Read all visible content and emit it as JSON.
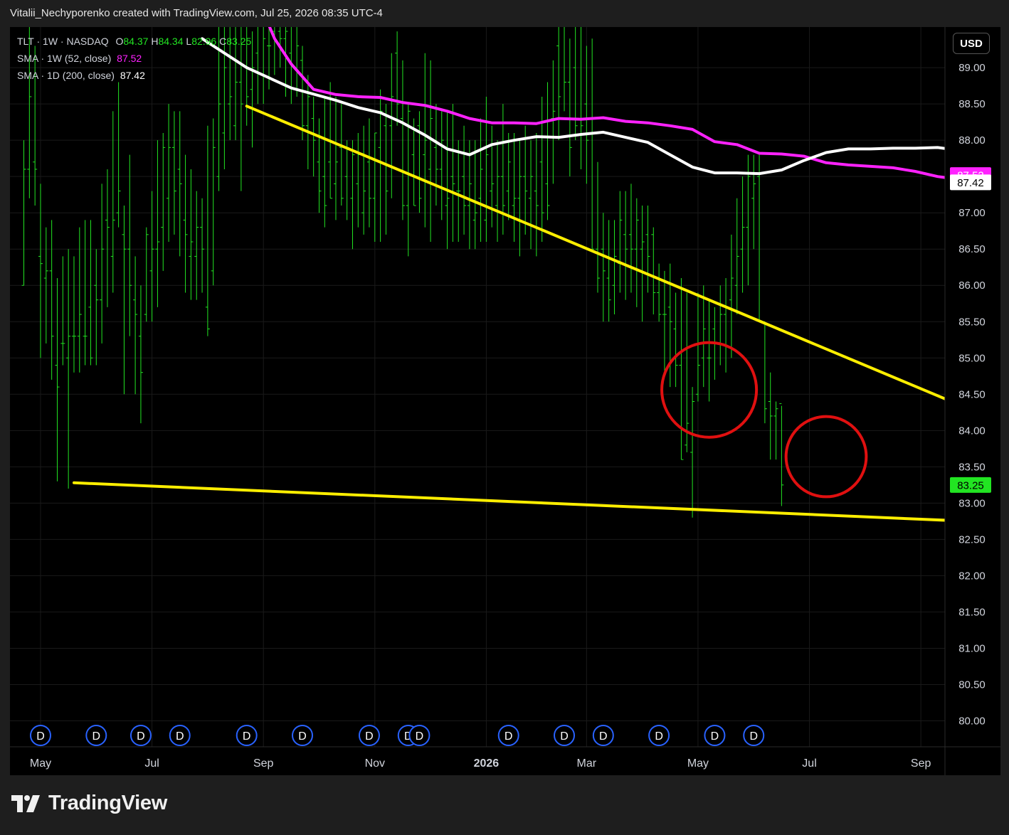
{
  "header": {
    "attribution": "Vitalii_Nechyporenko created with TradingView.com, Jul 25, 2026 08:35 UTC-4"
  },
  "legend": {
    "symbol": "TLT · 1W · NASDAQ",
    "o_label": "O",
    "o_value": "84.37",
    "h_label": "H",
    "h_value": "84.34",
    "l_label": "L",
    "l_value": "82.96",
    "c_label": "C",
    "c_value": "83.25",
    "sma1_label": "SMA · 1W (52, close)",
    "sma1_value": "87.52",
    "sma2_label": "SMA · 1D (200, close)",
    "sma2_value": "87.42"
  },
  "currency": "USD",
  "footer": {
    "brand": "TradingView"
  },
  "colors": {
    "background": "#000000",
    "bars": "#22e522",
    "sma52": "#ff22ff",
    "sma200": "#ffffff",
    "trendline": "#ffee00",
    "circle": "#e01010",
    "dividend": "#2962ff",
    "grid": "#1a1a1a"
  },
  "chart_data": {
    "type": "ohlc",
    "interval": "1W",
    "ylim": [
      79.85,
      89.55
    ],
    "y_ticks": [
      "80.00",
      "80.50",
      "81.00",
      "81.50",
      "82.00",
      "82.50",
      "83.00",
      "83.50",
      "84.00",
      "84.50",
      "85.00",
      "85.50",
      "86.00",
      "86.50",
      "87.00",
      "87.50",
      "88.00",
      "88.50",
      "89.00"
    ],
    "x_labels": [
      "May",
      "Jul",
      "Sep",
      "Nov",
      "2026",
      "Mar",
      "May",
      "Jul",
      "Sep"
    ],
    "x_label_index": [
      3,
      23,
      43,
      63,
      83,
      101,
      121,
      141,
      161
    ],
    "price_tags": [
      {
        "value": 87.52,
        "text": "87.52",
        "bg": "#ff22ff",
        "fg": "#ffffff"
      },
      {
        "value": 87.42,
        "text": "87.42",
        "bg": "#ffffff",
        "fg": "#000000"
      },
      {
        "value": 83.25,
        "text": "83.25",
        "bg": "#22e522",
        "fg": "#000000"
      }
    ],
    "ohlc": [
      [
        86.0,
        88.0,
        86.0,
        87.6
      ],
      [
        87.6,
        89.7,
        87.2,
        88.6
      ],
      [
        87.7,
        89.3,
        87.1,
        87.6
      ],
      [
        86.4,
        87.4,
        85.0,
        86.3
      ],
      [
        86.1,
        86.8,
        85.2,
        86.2
      ],
      [
        86.2,
        86.9,
        84.7,
        85.3
      ],
      [
        84.9,
        86.1,
        83.3,
        84.6
      ],
      [
        85.2,
        86.4,
        84.9,
        85.2
      ],
      [
        85.0,
        86.5,
        83.2,
        85.3
      ],
      [
        85.3,
        86.4,
        84.8,
        85.3
      ],
      [
        85.3,
        86.8,
        84.8,
        85.6
      ],
      [
        85.3,
        86.9,
        84.9,
        85.3
      ],
      [
        85.7,
        86.9,
        84.9,
        85.0
      ],
      [
        86.0,
        86.5,
        84.9,
        85.8
      ],
      [
        85.8,
        87.4,
        85.2,
        86.5
      ],
      [
        86.9,
        87.6,
        85.7,
        86.8
      ],
      [
        86.4,
        88.4,
        85.9,
        86.9
      ],
      [
        87.0,
        88.8,
        86.8,
        87.3
      ],
      [
        86.7,
        87.1,
        84.5,
        86.5
      ],
      [
        86.5,
        87.8,
        85.3,
        86.0
      ],
      [
        85.8,
        86.4,
        84.5,
        85.6
      ],
      [
        85.3,
        86.0,
        84.1,
        84.8
      ],
      [
        85.6,
        86.8,
        85.5,
        86.7
      ],
      [
        86.2,
        87.3,
        85.5,
        86.5
      ],
      [
        86.5,
        88.0,
        85.7,
        86.6
      ],
      [
        86.8,
        88.1,
        86.2,
        87.9
      ],
      [
        87.2,
        88.5,
        86.6,
        87.9
      ],
      [
        87.9,
        88.4,
        86.7,
        87.3
      ],
      [
        87.6,
        88.4,
        86.4,
        87.4
      ],
      [
        86.9,
        87.8,
        85.9,
        86.7
      ],
      [
        86.4,
        87.6,
        85.8,
        86.6
      ],
      [
        86.4,
        87.3,
        85.8,
        86.8
      ],
      [
        86.8,
        87.2,
        85.9,
        86.5
      ],
      [
        85.7,
        88.2,
        85.3,
        85.4
      ],
      [
        86.2,
        88.3,
        86.0,
        87.9
      ],
      [
        87.5,
        89.8,
        87.3,
        88.5
      ],
      [
        88.1,
        89.9,
        87.6,
        89.0
      ],
      [
        88.5,
        89.9,
        88.0,
        88.6
      ],
      [
        88.2,
        90.1,
        88.0,
        88.8
      ],
      [
        88.8,
        90.3,
        87.3,
        88.5
      ],
      [
        89.0,
        90.1,
        88.2,
        88.6
      ],
      [
        88.7,
        89.5,
        87.9,
        89.0
      ],
      [
        89.2,
        90.2,
        88.5,
        89.6
      ],
      [
        89.6,
        90.0,
        88.5,
        89.4
      ],
      [
        89.3,
        89.8,
        88.7,
        89.3
      ],
      [
        89.5,
        90.4,
        88.9,
        89.7
      ],
      [
        89.5,
        90.6,
        89.0,
        89.4
      ],
      [
        89.4,
        90.7,
        88.6,
        89.5
      ],
      [
        89.2,
        90.4,
        88.5,
        89.8
      ],
      [
        89.6,
        89.9,
        88.6,
        89.3
      ],
      [
        89.1,
        89.3,
        88.0,
        88.2
      ],
      [
        88.2,
        88.9,
        87.6,
        88.6
      ],
      [
        88.3,
        88.6,
        87.5,
        88.0
      ],
      [
        87.7,
        88.3,
        87.0,
        87.3
      ],
      [
        87.5,
        88.6,
        86.8,
        87.1
      ],
      [
        87.7,
        88.8,
        87.2,
        87.2
      ],
      [
        87.4,
        88.6,
        86.9,
        87.7
      ],
      [
        87.9,
        88.5,
        87.1,
        87.2
      ],
      [
        87.5,
        88.0,
        86.9,
        87.9
      ],
      [
        87.2,
        88.0,
        86.5,
        87.8
      ],
      [
        87.4,
        88.1,
        86.8,
        87.8
      ],
      [
        87.0,
        88.2,
        86.7,
        87.3
      ],
      [
        87.7,
        88.3,
        86.8,
        87.2
      ],
      [
        87.2,
        88.1,
        86.6,
        88.1
      ],
      [
        87.9,
        88.7,
        86.6,
        88.4
      ],
      [
        88.2,
        88.5,
        86.7,
        87.3
      ],
      [
        88.2,
        89.2,
        87.2,
        88.6
      ],
      [
        89.2,
        89.5,
        88.2,
        88.5
      ],
      [
        88.3,
        89.1,
        86.9,
        87.1
      ],
      [
        87.1,
        88.5,
        86.4,
        88.4
      ],
      [
        87.8,
        88.3,
        87.1,
        87.1
      ],
      [
        88.2,
        88.4,
        87.0,
        87.2
      ],
      [
        87.8,
        89.2,
        86.8,
        88.0
      ],
      [
        87.6,
        89.1,
        86.6,
        88.3
      ],
      [
        87.9,
        88.5,
        87.1,
        87.6
      ],
      [
        87.6,
        88.4,
        86.9,
        88.0
      ],
      [
        87.1,
        88.4,
        86.5,
        87.2
      ],
      [
        87.5,
        88.5,
        86.6,
        87.4
      ],
      [
        87.3,
        88.0,
        86.6,
        87.3
      ],
      [
        87.5,
        88.2,
        86.7,
        87.1
      ],
      [
        87.1,
        88.0,
        86.5,
        87.4
      ],
      [
        86.9,
        88.0,
        86.5,
        87.0
      ],
      [
        87.2,
        88.3,
        86.6,
        87.6
      ],
      [
        86.9,
        88.6,
        86.6,
        87.8
      ],
      [
        87.3,
        88.2,
        86.8,
        87.4
      ],
      [
        87.1,
        88.0,
        86.6,
        87.5
      ],
      [
        87.5,
        88.5,
        86.7,
        87.1
      ],
      [
        87.3,
        88.1,
        86.9,
        87.7
      ],
      [
        87.1,
        88.1,
        86.6,
        87.2
      ],
      [
        87.2,
        88.0,
        86.4,
        87.5
      ],
      [
        87.5,
        88.2,
        86.7,
        87.3
      ],
      [
        87.2,
        88.0,
        86.5,
        87.5
      ],
      [
        87.3,
        88.1,
        86.4,
        87.1
      ],
      [
        87.7,
        88.6,
        86.6,
        87.0
      ],
      [
        87.4,
        88.8,
        86.9,
        87.1
      ],
      [
        88.3,
        89.1,
        87.4,
        88.4
      ],
      [
        89.3,
        89.9,
        88.0,
        88.6
      ],
      [
        89.6,
        90.2,
        88.4,
        88.8
      ],
      [
        88.8,
        89.4,
        87.5,
        87.9
      ],
      [
        89.0,
        89.6,
        88.0,
        88.2
      ],
      [
        88.3,
        89.8,
        87.6,
        88.2
      ],
      [
        88.5,
        89.3,
        87.4,
        88.0
      ],
      [
        88.3,
        89.4,
        86.5,
        86.5
      ],
      [
        86.5,
        87.7,
        85.9,
        86.1
      ],
      [
        86.5,
        87.0,
        85.5,
        86.2
      ],
      [
        86.1,
        86.9,
        85.5,
        85.8
      ],
      [
        86.0,
        86.9,
        85.6,
        86.4
      ],
      [
        86.3,
        87.3,
        85.9,
        86.9
      ],
      [
        86.7,
        87.3,
        85.8,
        86.5
      ],
      [
        86.7,
        87.4,
        85.9,
        86.5
      ],
      [
        86.5,
        87.2,
        85.7,
        86.9
      ],
      [
        86.5,
        87.1,
        85.5,
        86.6
      ],
      [
        86.7,
        87.1,
        85.9,
        86.4
      ],
      [
        86.7,
        86.8,
        85.6,
        85.9
      ],
      [
        85.9,
        86.3,
        85.5,
        85.6
      ],
      [
        85.6,
        86.2,
        84.8,
        85.6
      ],
      [
        85.7,
        86.3,
        84.6,
        85.5
      ],
      [
        85.4,
        85.9,
        84.6,
        84.9
      ],
      [
        84.9,
        86.1,
        83.6,
        83.6
      ],
      [
        83.8,
        85.9,
        83.7,
        84.1
      ],
      [
        83.7,
        84.6,
        82.8,
        84.4
      ],
      [
        84.5,
        85.9,
        84.4,
        84.9
      ],
      [
        85.0,
        86.0,
        84.6,
        85.4
      ],
      [
        85.0,
        85.8,
        84.4,
        85.0
      ],
      [
        85.4,
        85.7,
        84.7,
        85.2
      ],
      [
        85.2,
        86.0,
        84.9,
        85.6
      ],
      [
        85.6,
        86.1,
        84.8,
        85.7
      ],
      [
        85.8,
        86.7,
        85.0,
        86.1
      ],
      [
        86.0,
        87.2,
        85.6,
        86.4
      ],
      [
        86.5,
        87.5,
        85.9,
        86.8
      ],
      [
        86.8,
        87.8,
        86.0,
        87.5
      ],
      [
        87.2,
        87.8,
        86.5,
        87.4
      ],
      [
        87.5,
        87.8,
        85.5,
        85.5
      ],
      [
        85.5,
        85.5,
        84.1,
        84.3
      ],
      [
        84.4,
        84.8,
        83.6,
        84.2
      ],
      [
        84.2,
        84.4,
        83.6,
        84.3
      ],
      [
        84.37,
        84.34,
        82.96,
        83.25
      ]
    ],
    "series": [
      {
        "name": "SMA · 1W (52, close)",
        "color": "#ff22ff",
        "points": [
          [
            40,
            90.3
          ],
          [
            45,
            89.4
          ],
          [
            48,
            89.05
          ],
          [
            52,
            88.7
          ],
          [
            56,
            88.63
          ],
          [
            60,
            88.6
          ],
          [
            64,
            88.59
          ],
          [
            68,
            88.52
          ],
          [
            72,
            88.48
          ],
          [
            76,
            88.4
          ],
          [
            80,
            88.3
          ],
          [
            84,
            88.24
          ],
          [
            88,
            88.24
          ],
          [
            92,
            88.23
          ],
          [
            96,
            88.3
          ],
          [
            100,
            88.29
          ],
          [
            104,
            88.31
          ],
          [
            108,
            88.26
          ],
          [
            112,
            88.24
          ],
          [
            116,
            88.2
          ],
          [
            120,
            88.15
          ],
          [
            124,
            87.98
          ],
          [
            128,
            87.94
          ],
          [
            132,
            87.82
          ],
          [
            136,
            87.81
          ],
          [
            140,
            87.78
          ],
          [
            144,
            87.69
          ],
          [
            148,
            87.66
          ],
          [
            152,
            87.64
          ],
          [
            156,
            87.62
          ],
          [
            160,
            87.57
          ],
          [
            164,
            87.5
          ],
          [
            168,
            87.46
          ],
          [
            172,
            87.43
          ],
          [
            176,
            87.36
          ],
          [
            180,
            87.15
          ],
          [
            184,
            87.19
          ],
          [
            188,
            87.0
          ]
        ]
      },
      {
        "name": "SMA · 1D (200, close)",
        "color": "#ffffff",
        "points": [
          [
            32,
            89.4
          ],
          [
            40,
            89.0
          ],
          [
            48,
            88.72
          ],
          [
            56,
            88.55
          ],
          [
            60,
            88.45
          ],
          [
            64,
            88.38
          ],
          [
            68,
            88.24
          ],
          [
            72,
            88.07
          ],
          [
            76,
            87.88
          ],
          [
            80,
            87.8
          ],
          [
            84,
            87.94
          ],
          [
            88,
            88.0
          ],
          [
            92,
            88.05
          ],
          [
            96,
            88.04
          ],
          [
            100,
            88.08
          ],
          [
            104,
            88.11
          ],
          [
            108,
            88.04
          ],
          [
            112,
            87.97
          ],
          [
            116,
            87.8
          ],
          [
            120,
            87.63
          ],
          [
            124,
            87.55
          ],
          [
            128,
            87.55
          ],
          [
            132,
            87.54
          ],
          [
            136,
            87.59
          ],
          [
            140,
            87.72
          ],
          [
            144,
            87.83
          ],
          [
            148,
            87.88
          ],
          [
            152,
            87.88
          ],
          [
            156,
            87.89
          ],
          [
            160,
            87.89
          ],
          [
            164,
            87.9
          ],
          [
            168,
            87.86
          ],
          [
            172,
            87.86
          ],
          [
            176,
            87.86
          ],
          [
            180,
            87.65
          ],
          [
            184,
            87.55
          ],
          [
            188,
            87.42
          ]
        ]
      }
    ],
    "drawings": {
      "lines": [
        {
          "from": [
            40,
            88.47
          ],
          "to": [
            210,
            83.0
          ]
        },
        {
          "from": [
            9,
            83.28
          ],
          "to": [
            212,
            82.61
          ]
        }
      ],
      "circles": [
        {
          "center": [
            123,
            84.56
          ],
          "radius_bars": 8.5
        },
        {
          "center": [
            144,
            83.64
          ],
          "radius_bars": 7.2
        }
      ]
    },
    "dividends": [
      3,
      13,
      21,
      28,
      40,
      50,
      62,
      69,
      71,
      87,
      97,
      104,
      114,
      124,
      131
    ]
  }
}
